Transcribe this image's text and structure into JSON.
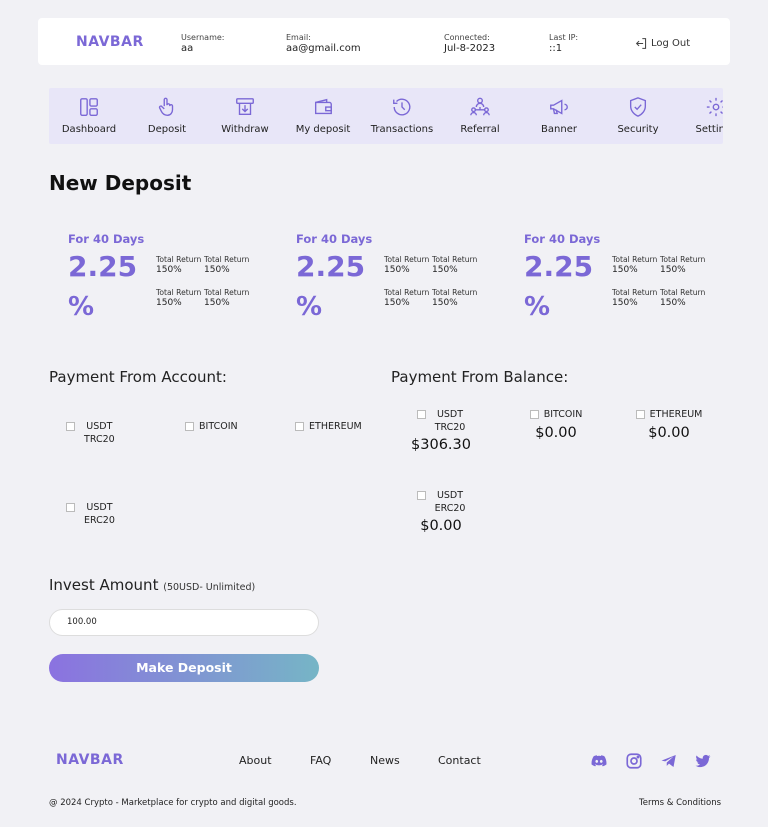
{
  "header": {
    "brand": "NAVBAR",
    "username_label": "Username:",
    "username": "aa",
    "email_label": "Email:",
    "email": "aa@gmail.com",
    "connected_label": "Connected:",
    "connected": "Jul-8-2023",
    "ip_label": "Last IP:",
    "ip": "::1",
    "logout": "Log Out"
  },
  "nav": [
    "Dashboard",
    "Deposit",
    "Withdraw",
    "My deposit",
    "Transactions",
    "Referral",
    "Banner",
    "Security",
    "Settings"
  ],
  "page_title": "New Deposit",
  "plans": [
    {
      "days": "For 40 Days",
      "rate": "2.25",
      "pct": "%",
      "ret_label": "Total Return",
      "ret_value": "150%"
    },
    {
      "days": "For 40 Days",
      "rate": "2.25",
      "pct": "%",
      "ret_label": "Total Return",
      "ret_value": "150%"
    },
    {
      "days": "For 40 Days",
      "rate": "2.25",
      "pct": "%",
      "ret_label": "Total Return",
      "ret_value": "150%"
    }
  ],
  "payment_account": {
    "title": "Payment From Account:",
    "coins": [
      {
        "l1": "USDT",
        "l2": "TRC20"
      },
      {
        "l1": "BITCOIN",
        "l2": ""
      },
      {
        "l1": "ETHEREUM",
        "l2": ""
      },
      {
        "l1": "USDT",
        "l2": "ERC20"
      }
    ]
  },
  "payment_balance": {
    "title": "Payment From Balance:",
    "coins": [
      {
        "l1": "USDT",
        "l2": "TRC20",
        "balance": "$306.30"
      },
      {
        "l1": "BITCOIN",
        "l2": "",
        "balance": "$0.00"
      },
      {
        "l1": "ETHEREUM",
        "l2": "",
        "balance": "$0.00"
      },
      {
        "l1": "USDT",
        "l2": "ERC20",
        "balance": "$0.00"
      }
    ]
  },
  "invest": {
    "label": "Invest Amount",
    "range": "(50USD- Unlimited)",
    "value": "100.00",
    "button": "Make Deposit"
  },
  "footer": {
    "brand": "NAVBAR",
    "links": [
      "About",
      "FAQ",
      "News",
      "Contact"
    ],
    "social_icons": [
      "discord-icon",
      "instagram-icon",
      "telegram-icon",
      "twitter-icon"
    ],
    "copyright": "@ 2024 Crypto - Marketplace for crypto and digital goods.",
    "terms": "Terms & Conditions"
  },
  "colors": {
    "accent": "#7b68d6",
    "background": "#f1f1f5",
    "nav_bg": "#e8e6f8"
  }
}
